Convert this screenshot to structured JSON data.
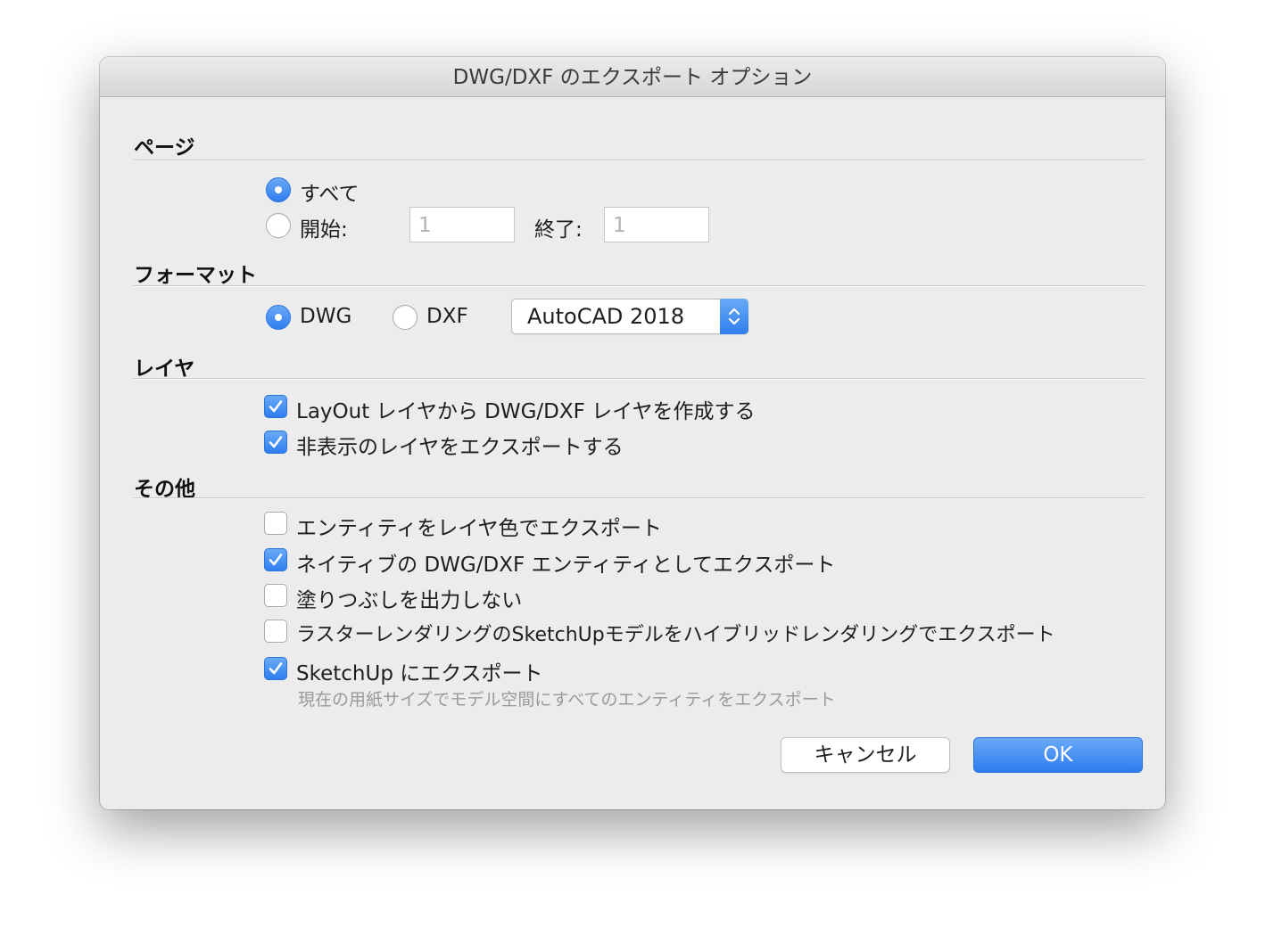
{
  "window": {
    "title": "DWG/DXF のエクスポート オプション"
  },
  "pages": {
    "section_title": "ページ",
    "all_label": "すべて",
    "all_selected": true,
    "start_label": "開始:",
    "start_placeholder": "1",
    "end_label": "終了:",
    "end_placeholder": "1"
  },
  "format": {
    "section_title": "フォーマット",
    "dwg_label": "DWG",
    "dwg_selected": true,
    "dxf_label": "DXF",
    "dxf_selected": false,
    "version_selected": "AutoCAD 2018"
  },
  "layers": {
    "section_title": "レイヤ",
    "options": [
      {
        "label": "LayOut レイヤから DWG/DXF レイヤを作成する",
        "checked": true
      },
      {
        "label": "非表示のレイヤをエクスポートする",
        "checked": true
      }
    ]
  },
  "other": {
    "section_title": "その他",
    "options": [
      {
        "label": "エンティティをレイヤ色でエクスポート",
        "checked": false
      },
      {
        "label": "ネイティブの DWG/DXF エンティティとしてエクスポート",
        "checked": true
      },
      {
        "label": "塗りつぶしを出力しない",
        "checked": false
      },
      {
        "label": "ラスターレンダリングのSketchUpモデルをハイブリッドレンダリングでエクスポート",
        "checked": false
      },
      {
        "label": "SketchUp にエクスポート",
        "checked": true
      }
    ],
    "sketchup_description": "現在の用紙サイズでモデル空間にすべてのエンティティをエクスポート"
  },
  "buttons": {
    "cancel_label": "キャンセル",
    "ok_label": "OK"
  },
  "colors": {
    "accent": "#3a87f2",
    "window_bg": "#ececec"
  }
}
